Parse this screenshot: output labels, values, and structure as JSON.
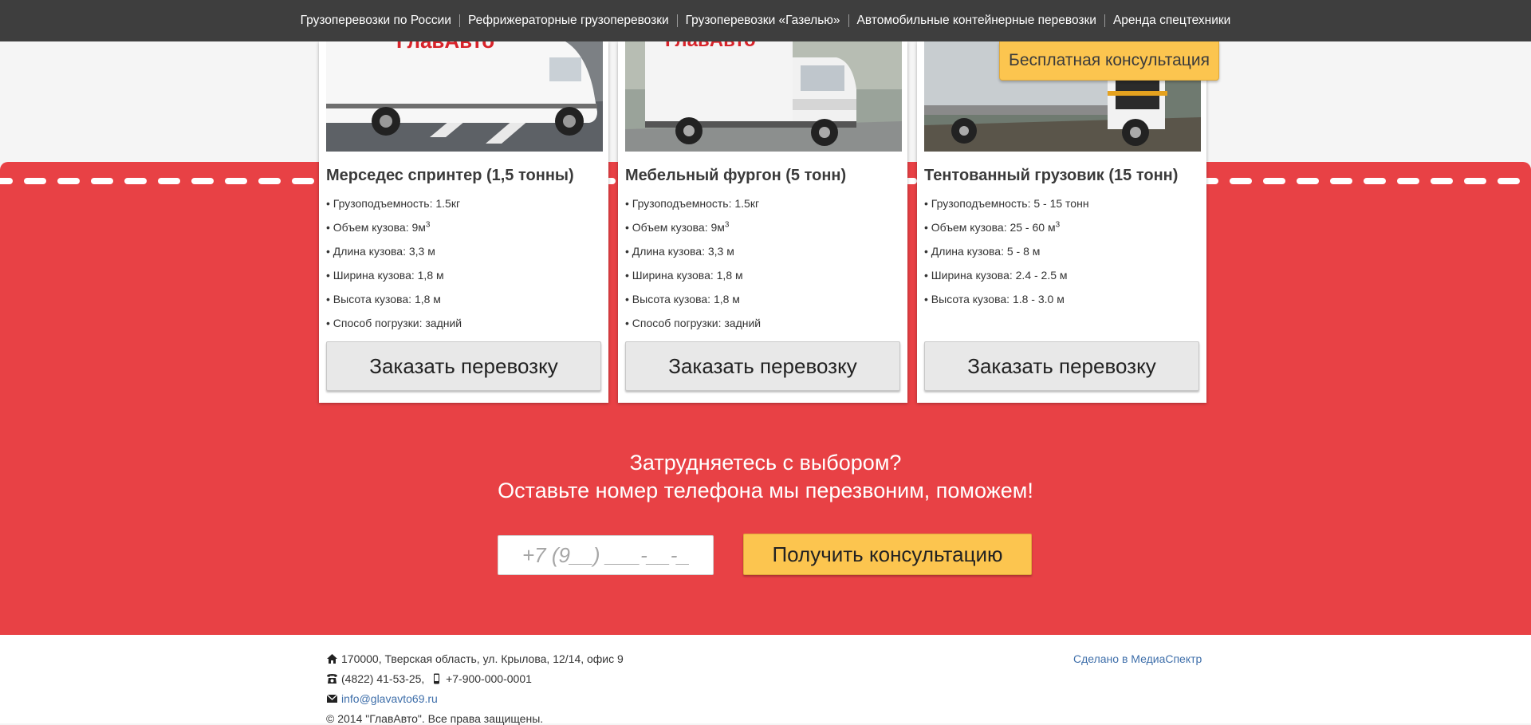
{
  "nav": {
    "items": [
      {
        "label": "Грузоперевозки по России"
      },
      {
        "label": "Рефрижераторные грузоперевозки"
      },
      {
        "label": "Грузоперевозки «Газелью»"
      },
      {
        "label": "Автомобильные контейнерные перевозки"
      },
      {
        "label": "Аренда спецтехники"
      }
    ]
  },
  "consult_badge": "Бесплатная консультация",
  "cards": [
    {
      "title": "Мерседес спринтер (1,5 тонны)",
      "logo_text": "ГлавАвто",
      "specs": [
        {
          "label": "Грузоподъемность:",
          "value": "1.5кг"
        },
        {
          "label": "Объем кузова:",
          "value": "9м",
          "sup": "3"
        },
        {
          "label": "Длина кузова:",
          "value": "3,3 м"
        },
        {
          "label": "Ширина кузова:",
          "value": "1,8 м"
        },
        {
          "label": "Высота кузова:",
          "value": "1,8 м"
        },
        {
          "label": "Способ погрузки:",
          "value": "задний"
        }
      ],
      "button": "Заказать перевозку"
    },
    {
      "title": "Мебельный фургон (5 тонн)",
      "logo_text": "ГлавАвто",
      "specs": [
        {
          "label": "Грузоподъемность:",
          "value": "1.5кг"
        },
        {
          "label": "Объем кузова:",
          "value": "9м",
          "sup": "3"
        },
        {
          "label": "Длина кузова:",
          "value": "3,3 м"
        },
        {
          "label": "Ширина кузова:",
          "value": "1,8 м"
        },
        {
          "label": "Высота кузова:",
          "value": "1,8 м"
        },
        {
          "label": "Способ погрузки:",
          "value": "задний"
        }
      ],
      "button": "Заказать перевозку"
    },
    {
      "title": "Тентованный грузовик (15 тонн)",
      "specs": [
        {
          "label": "Грузоподъемность:",
          "value": "5 - 15 тонн"
        },
        {
          "label": "Объем кузова:",
          "value": "25 - 60 м",
          "sup": "3"
        },
        {
          "label": "Длина кузова:",
          "value": "5 - 8 м"
        },
        {
          "label": "Ширина кузова:",
          "value": "2.4 - 2.5 м"
        },
        {
          "label": "Высота кузова:",
          "value": "1.8 - 3.0 м"
        }
      ],
      "button": "Заказать перевозку"
    }
  ],
  "cta": {
    "line1": "Затрудняетесь с выбором?",
    "line2": "Оставьте номер телефона мы перезвоним, поможем!",
    "phone_placeholder": "+7 (9__) ___-__-__",
    "button": "Получить консультацию"
  },
  "footer": {
    "address": "170000, Тверская область, ул. Крылова, 12/14, офис 9",
    "phone1": "(4822) 41-53-25,",
    "phone2": "+7-900-000-0001",
    "email": "info@glavavto69.ru",
    "copyright": "© 2014 \"ГлавАвто\". Все права защищены.",
    "credit": "Сделано в МедиаСпектр"
  },
  "colors": {
    "nav_bg": "#3e3e3e",
    "accent_red": "#e84145",
    "accent_yellow": "#fcc54f",
    "link_blue": "#3f6faa"
  }
}
